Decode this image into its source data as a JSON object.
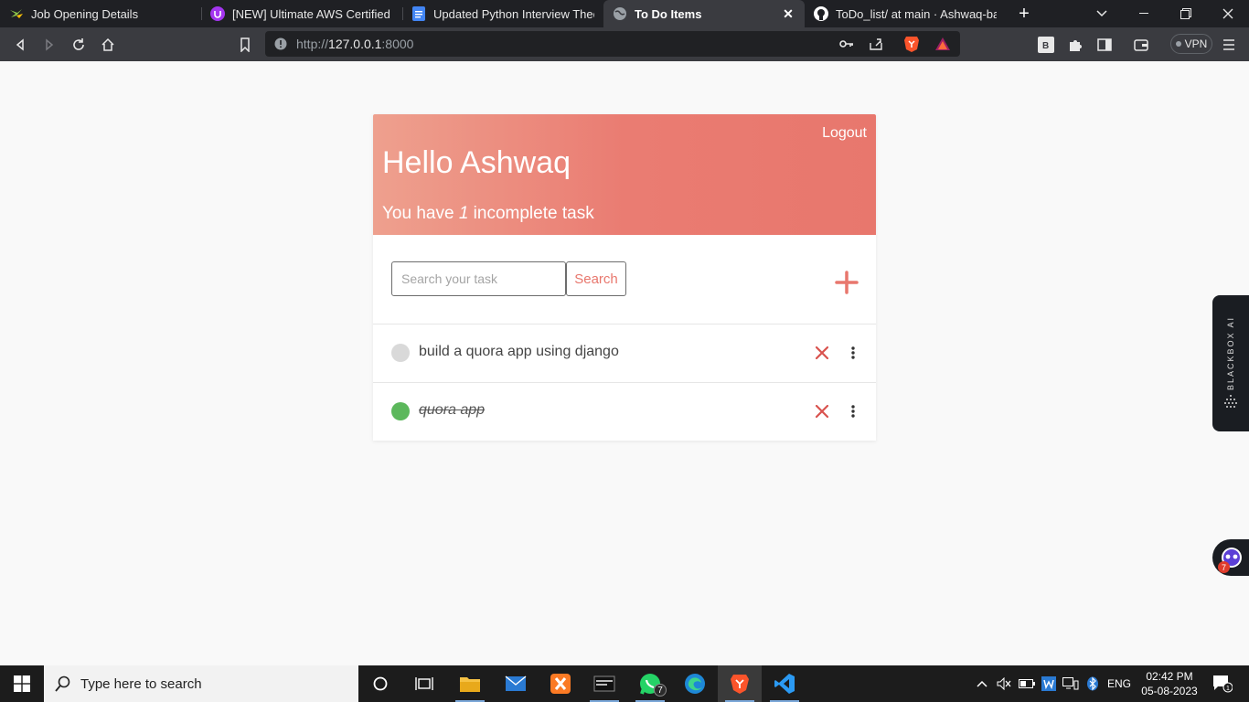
{
  "browser": {
    "tabs": [
      {
        "title": "Job Opening Details",
        "icon": "bird-favicon",
        "active": false
      },
      {
        "title": "[NEW] Ultimate AWS Certified Clou",
        "icon": "udemy-favicon",
        "active": false
      },
      {
        "title": "Updated Python Interview Theory",
        "icon": "docs-favicon",
        "active": false
      },
      {
        "title": "To Do Items",
        "icon": "globe-favicon",
        "active": true
      },
      {
        "title": "ToDo_list/ at main · Ashwaq-basha",
        "icon": "github-favicon",
        "active": false
      }
    ],
    "new_tab_label": "+",
    "url_prefix": "http://",
    "url_host": "127.0.0.1",
    "url_port": ":8000",
    "vpn_label": "VPN"
  },
  "app": {
    "logout_label": "Logout",
    "greeting": "Hello Ashwaq",
    "summary_prefix": "You have ",
    "incomplete_count": "1",
    "summary_suffix": " incomplete task",
    "search_placeholder": "Search your task",
    "search_button_label": "Search",
    "tasks": [
      {
        "title": "build a quora app using django",
        "complete": false
      },
      {
        "title": "quora app",
        "complete": true
      }
    ]
  },
  "extensions": {
    "blackbox_label": "BLACKBOX AI",
    "bot_badge_count": "7"
  },
  "taskbar": {
    "search_placeholder": "Type here to search",
    "whatsapp_badge": "7",
    "language": "ENG",
    "time": "02:42 PM",
    "date": "05-08-2023"
  },
  "colors": {
    "accent": "#e8776d",
    "task_incomplete_dot": "#d9d9d9",
    "task_complete_dot": "#5cb85c",
    "delete_icon": "#d9534f"
  }
}
